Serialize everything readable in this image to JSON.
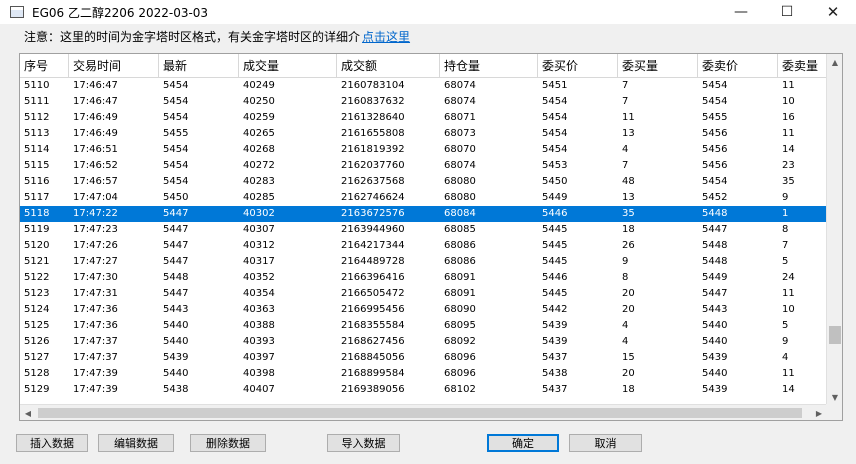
{
  "window": {
    "title": "EG06 乙二醇2206 2022-03-03",
    "controls": {
      "minimize": "—",
      "maximize": "☐",
      "close": "✕"
    }
  },
  "notice": {
    "text": "注意：这里的时间为金字塔时区格式，有关金字塔时区的详细介",
    "link": "点击这里"
  },
  "table": {
    "columns": [
      "序号",
      "交易时间",
      "最新",
      "成交量",
      "成交额",
      "持仓量",
      "委买价",
      "委买量",
      "委卖价",
      "委卖量"
    ],
    "selected_index": 8,
    "rows": [
      [
        "5110",
        "17:46:47",
        "5454",
        "40249",
        "2160783104",
        "68074",
        "5451",
        "7",
        "5454",
        "11"
      ],
      [
        "5111",
        "17:46:47",
        "5454",
        "40250",
        "2160837632",
        "68074",
        "5454",
        "7",
        "5454",
        "10"
      ],
      [
        "5112",
        "17:46:49",
        "5454",
        "40259",
        "2161328640",
        "68071",
        "5454",
        "11",
        "5455",
        "16"
      ],
      [
        "5113",
        "17:46:49",
        "5455",
        "40265",
        "2161655808",
        "68073",
        "5454",
        "13",
        "5456",
        "11"
      ],
      [
        "5114",
        "17:46:51",
        "5454",
        "40268",
        "2161819392",
        "68070",
        "5454",
        "4",
        "5456",
        "14"
      ],
      [
        "5115",
        "17:46:52",
        "5454",
        "40272",
        "2162037760",
        "68074",
        "5453",
        "7",
        "5456",
        "23"
      ],
      [
        "5116",
        "17:46:57",
        "5454",
        "40283",
        "2162637568",
        "68080",
        "5450",
        "48",
        "5454",
        "35"
      ],
      [
        "5117",
        "17:47:04",
        "5450",
        "40285",
        "2162746624",
        "68080",
        "5449",
        "13",
        "5452",
        "9"
      ],
      [
        "5118",
        "17:47:22",
        "5447",
        "40302",
        "2163672576",
        "68084",
        "5446",
        "35",
        "5448",
        "1"
      ],
      [
        "5119",
        "17:47:23",
        "5447",
        "40307",
        "2163944960",
        "68085",
        "5445",
        "18",
        "5447",
        "8"
      ],
      [
        "5120",
        "17:47:26",
        "5447",
        "40312",
        "2164217344",
        "68086",
        "5445",
        "26",
        "5448",
        "7"
      ],
      [
        "5121",
        "17:47:27",
        "5447",
        "40317",
        "2164489728",
        "68086",
        "5445",
        "9",
        "5448",
        "5"
      ],
      [
        "5122",
        "17:47:30",
        "5448",
        "40352",
        "2166396416",
        "68091",
        "5446",
        "8",
        "5449",
        "24"
      ],
      [
        "5123",
        "17:47:31",
        "5447",
        "40354",
        "2166505472",
        "68091",
        "5445",
        "20",
        "5447",
        "11"
      ],
      [
        "5124",
        "17:47:36",
        "5443",
        "40363",
        "2166995456",
        "68090",
        "5442",
        "20",
        "5443",
        "10"
      ],
      [
        "5125",
        "17:47:36",
        "5440",
        "40388",
        "2168355584",
        "68095",
        "5439",
        "4",
        "5440",
        "5"
      ],
      [
        "5126",
        "17:47:37",
        "5440",
        "40393",
        "2168627456",
        "68092",
        "5439",
        "4",
        "5440",
        "9"
      ],
      [
        "5127",
        "17:47:37",
        "5439",
        "40397",
        "2168845056",
        "68096",
        "5437",
        "15",
        "5439",
        "4"
      ],
      [
        "5128",
        "17:47:39",
        "5440",
        "40398",
        "2168899584",
        "68096",
        "5438",
        "20",
        "5440",
        "11"
      ],
      [
        "5129",
        "17:47:39",
        "5438",
        "40407",
        "2169389056",
        "68102",
        "5437",
        "18",
        "5439",
        "14"
      ]
    ]
  },
  "scrollbars": {
    "up": "▲",
    "down": "▼",
    "left": "◀",
    "right": "▶"
  },
  "buttons": {
    "insert": "插入数据",
    "edit": "编辑数据",
    "delete": "删除数据",
    "import": "导入数据",
    "ok": "确定",
    "cancel": "取消"
  }
}
